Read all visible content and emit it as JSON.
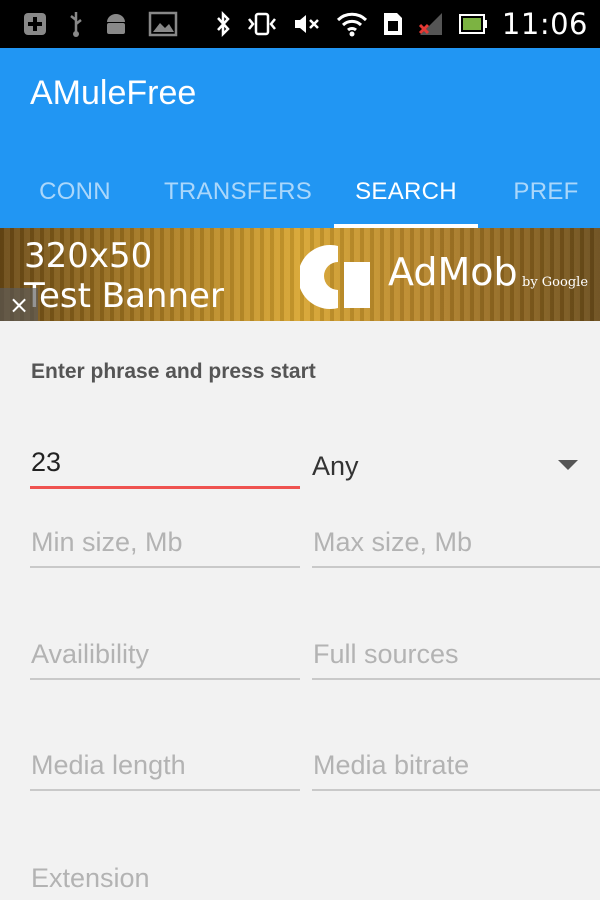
{
  "status_bar": {
    "time": "11:06",
    "left_icons": [
      "add-icon",
      "usb-icon",
      "android-icon",
      "image-icon"
    ],
    "right_icons": [
      "bluetooth-icon",
      "vibrate-icon",
      "mute-icon",
      "wifi-icon",
      "sim-icon",
      "signal-icon",
      "battery-icon"
    ]
  },
  "app": {
    "title": "AMuleFree",
    "accent_color": "#2196f3",
    "tabs": [
      {
        "label": "CONN"
      },
      {
        "label": "TRANSFERS"
      },
      {
        "label": "SEARCH",
        "active": true
      },
      {
        "label": "PREF"
      }
    ]
  },
  "ad": {
    "line1": "320x50",
    "line2": "Test Banner",
    "close": "×",
    "brand": "AdMob",
    "by": "by Google"
  },
  "search": {
    "instruction": "Enter phrase and press start",
    "query_value": "23",
    "type_select": "Any",
    "min_size_placeholder": "Min size, Mb",
    "max_size_placeholder": "Max size, Mb",
    "availability_placeholder": "Availibility",
    "full_sources_placeholder": "Full sources",
    "media_length_placeholder": "Media length",
    "media_bitrate_placeholder": "Media bitrate",
    "extension_placeholder": "Extension"
  }
}
